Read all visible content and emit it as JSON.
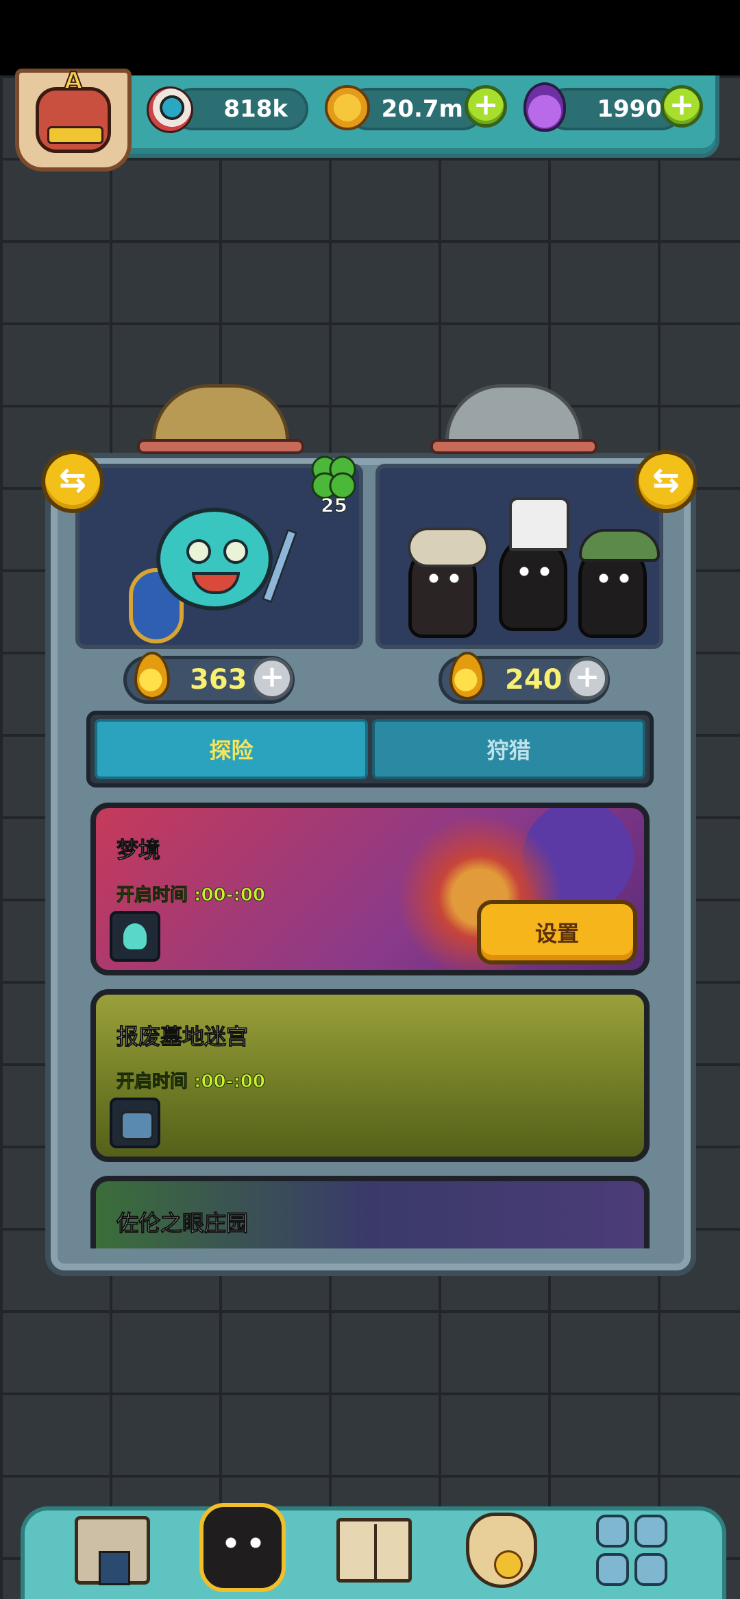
{
  "resources": {
    "eyes": "818k",
    "coins": "20.7m",
    "potions": "1990",
    "plus_label": "+",
    "player_rank": "A"
  },
  "squad": {
    "clover_count": "25",
    "left_energy": "363",
    "right_energy": "240",
    "swap_label": "⇆",
    "energy_plus": "+"
  },
  "tabs": [
    {
      "label": "探险",
      "active": true
    },
    {
      "label": "狩猎",
      "active": false
    }
  ],
  "maps": [
    {
      "title": "梦境",
      "time": "开启时间 :00-:00",
      "button": "设置"
    },
    {
      "title": "报废墓地迷宫",
      "time": "开启时间 :00-:00"
    },
    {
      "title": "佐伦之眼庄园"
    }
  ],
  "nav": [
    "shop-icon",
    "monster-icon",
    "book-icon",
    "bag-icon",
    "grid-icon"
  ],
  "colors": {
    "accent": "#f7b51c",
    "teal": "#3aa6a8",
    "lime": "#a8de2c"
  }
}
